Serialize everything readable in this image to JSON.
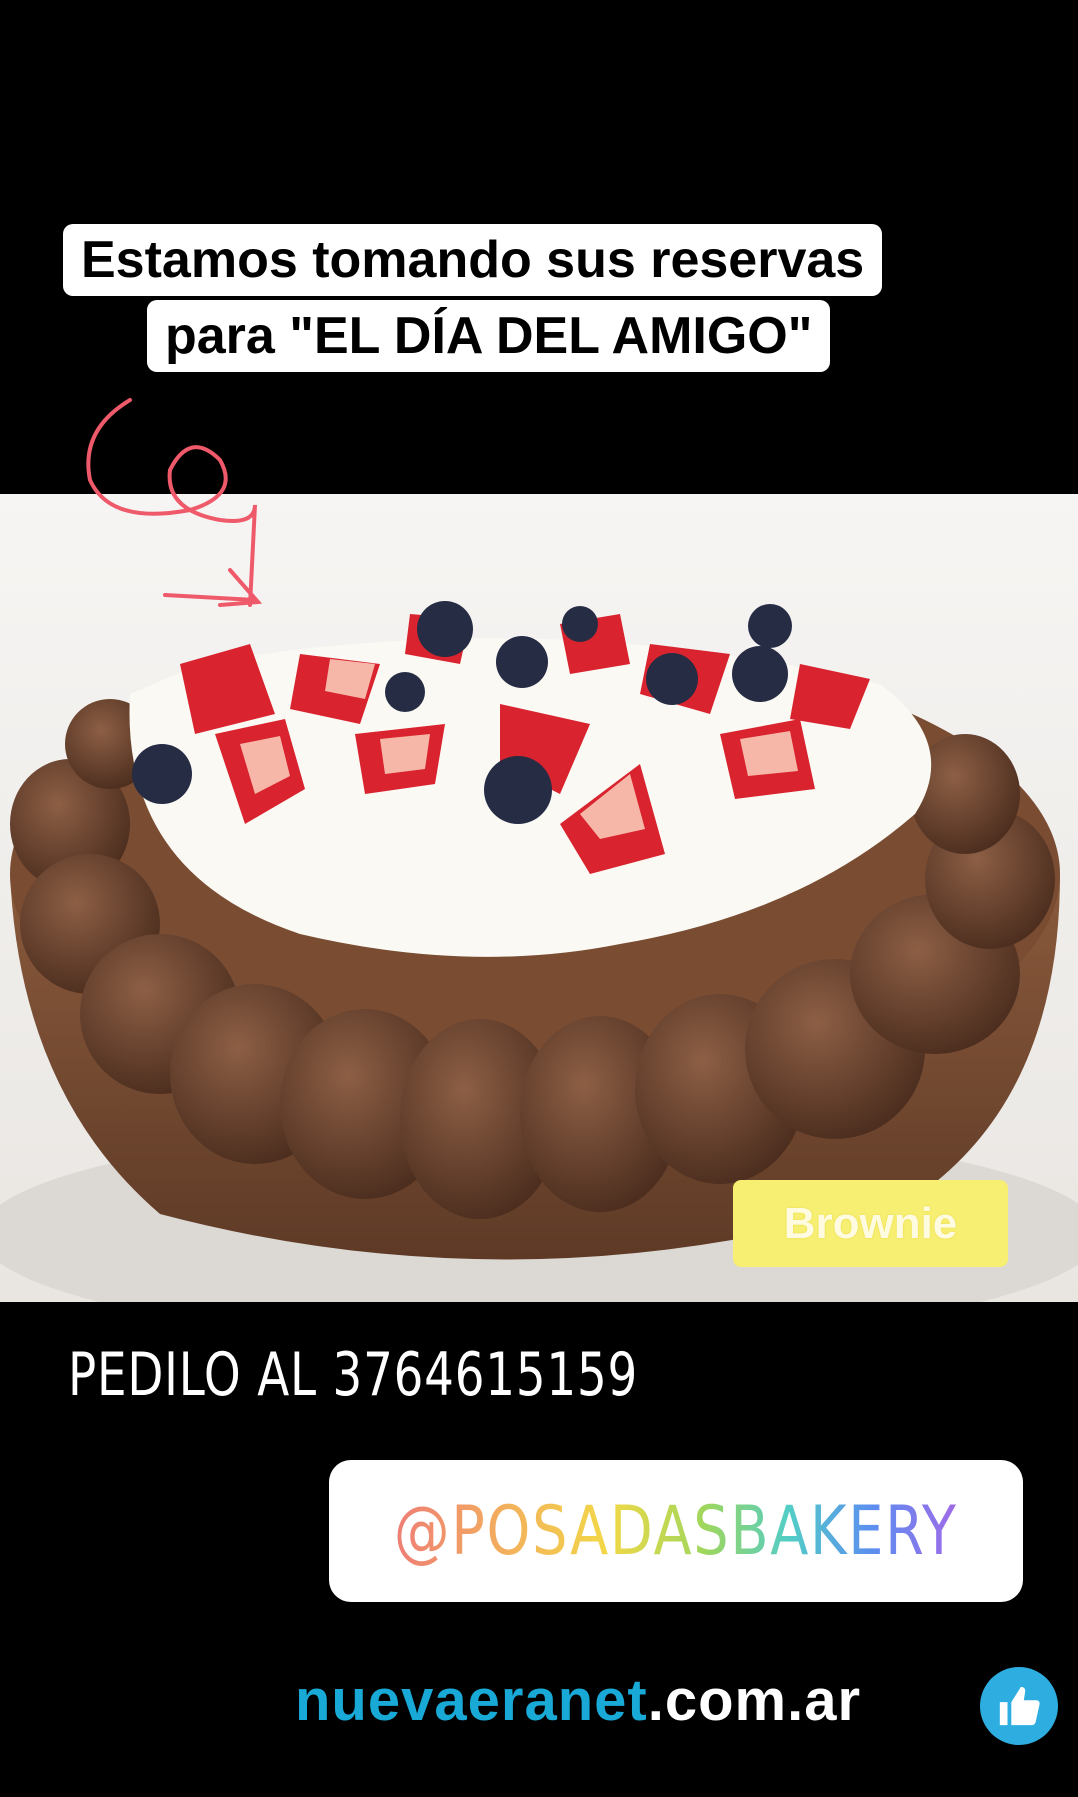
{
  "headline": {
    "line1": "Estamos tomando sus reservas",
    "line2": "para \"EL DÍA DEL AMIGO\""
  },
  "photo": {
    "tag": "Brownie"
  },
  "order": {
    "text": "PEDILO AL 3764615159"
  },
  "instagram": {
    "handle": "@POSADASBAKERY"
  },
  "website": {
    "part1": "nuevaeranet",
    "part2": ".com.ar"
  },
  "icons": {
    "arrow": "curly-arrow-icon",
    "like": "thumbs-up-icon"
  },
  "colors": {
    "accent_blue": "#18a9d6",
    "tag_yellow": "#f7ef72",
    "arrow_red": "#ef5a6a"
  }
}
